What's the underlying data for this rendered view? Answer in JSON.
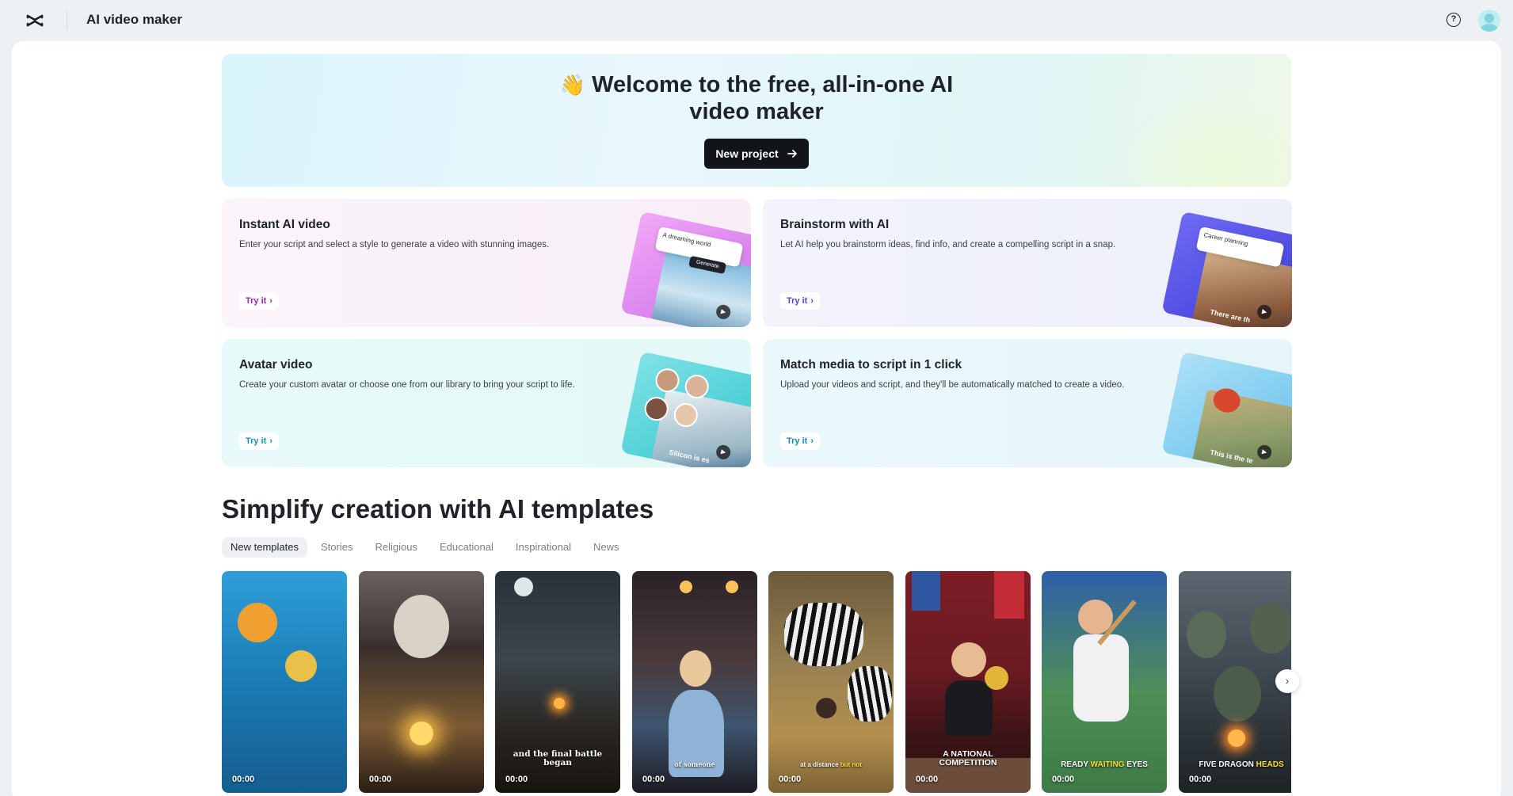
{
  "app": {
    "title": "AI video maker",
    "help_symbol": "?"
  },
  "hero": {
    "emoji": "👋",
    "title_line1": "Welcome to the free, all-in-one AI",
    "title_line2": "video maker",
    "button_label": "New project"
  },
  "features": [
    {
      "title": "Instant AI video",
      "description": "Enter your script and select a style to generate a video with stunning images.",
      "cta": "Try it",
      "chip_text": "A dreaming world",
      "chip_button": "Generate"
    },
    {
      "title": "Brainstorm with AI",
      "description": "Let AI help you brainstorm ideas, find info, and create a compelling script in a snap.",
      "cta": "Try it",
      "chip_text": "Career planning",
      "photo_caption": "There are th"
    },
    {
      "title": "Avatar video",
      "description": "Create your custom avatar or choose one from our library to bring your script to life.",
      "cta": "Try it",
      "photo_caption": "Silicon is es"
    },
    {
      "title": "Match media to script in 1 click",
      "description": "Upload your videos and script, and they'll be automatically matched to create a video.",
      "cta": "Try it",
      "photo_caption": "This is the te"
    }
  ],
  "templates": {
    "title": "Simplify creation with AI templates",
    "tabs": [
      "New templates",
      "Stories",
      "Religious",
      "Educational",
      "Inspirational",
      "News"
    ],
    "active_tab": "New templates",
    "items": [
      {
        "caption": "",
        "duration": "00:00"
      },
      {
        "caption": "",
        "duration": "00:00"
      },
      {
        "caption": "and the final battle began",
        "duration": "00:00"
      },
      {
        "caption": "of someone",
        "duration": "00:00"
      },
      {
        "caption_a": "at a distance ",
        "caption_b": "but not",
        "duration": "00:00"
      },
      {
        "caption_a": "A NATIONAL",
        "caption_b": "COMPETITION",
        "duration": "00:00"
      },
      {
        "caption_a": "READY ",
        "caption_b": "WAITING",
        "caption_c": " EYES",
        "duration": "00:00"
      },
      {
        "caption_a": "FIVE DRAGON ",
        "caption_b": "HEADS",
        "duration": "00:00"
      }
    ]
  },
  "icons": {
    "logo": "capcut-logo-icon",
    "arrow": "arrow-right-icon",
    "chevron": "chevron-right-icon",
    "help": "help-circle-icon",
    "avatar": "user-avatar-icon"
  }
}
